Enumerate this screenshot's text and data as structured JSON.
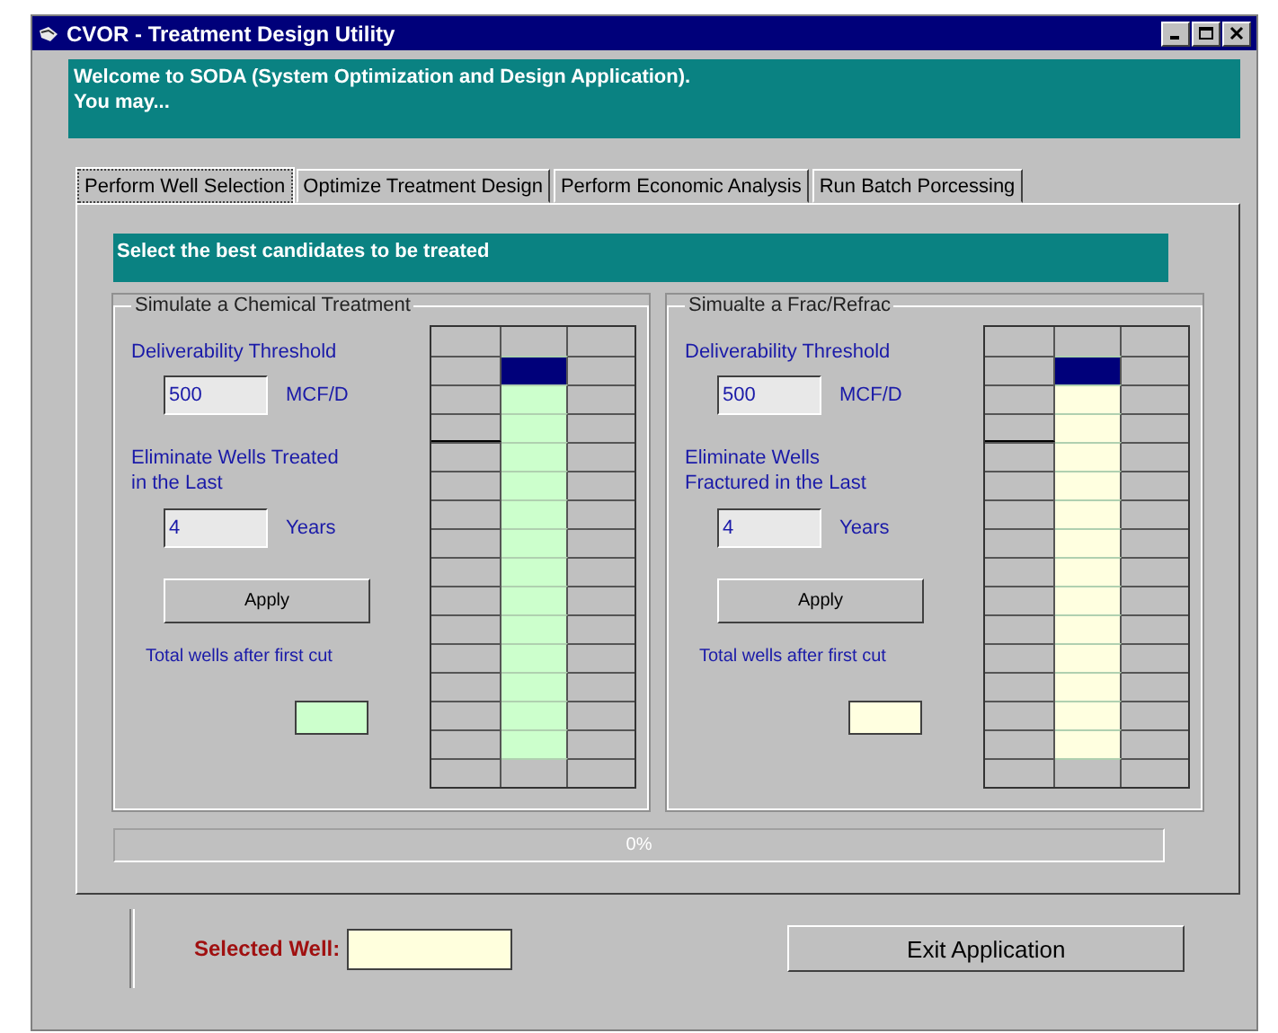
{
  "window": {
    "title": "CVOR - Treatment Design Utility"
  },
  "banner": {
    "lines": [
      "Welcome to SODA (System Optimization and Design Application).",
      "You may..."
    ]
  },
  "tabs": [
    {
      "label": "Perform Well Selection",
      "selected": true
    },
    {
      "label": "Optimize Treatment Design",
      "selected": false
    },
    {
      "label": "Perform Economic Analysis",
      "selected": false
    },
    {
      "label": "Run Batch Porcessing",
      "selected": false
    }
  ],
  "panel": {
    "heading": "Select the best candidates to be treated",
    "groups": [
      {
        "legend": "Simulate a Chemical Treatment",
        "color": "#ccffcc",
        "threshold_label": "Deliverability Threshold",
        "threshold_value": "500",
        "threshold_unit": "MCF/D",
        "eliminate_lines": [
          "Eliminate Wells Treated",
          "in the Last"
        ],
        "years_value": "4",
        "years_unit": "Years",
        "apply_button": "Apply",
        "total_label": "Total wells after first cut"
      },
      {
        "legend": "Simualte a Frac/Refrac",
        "color": "#ffffe0",
        "threshold_label": "Deliverability Threshold",
        "threshold_value": "500",
        "threshold_unit": "MCF/D",
        "eliminate_lines": [
          "Eliminate Wells",
          "Fractured in the Last"
        ],
        "years_value": "4",
        "years_unit": "Years",
        "apply_button": "Apply",
        "total_label": "Total wells after first cut"
      }
    ],
    "progress": {
      "level": 0,
      "reading": "0%"
    }
  },
  "footer": {
    "selected_well_label": "Selected Well:",
    "exit_button": "Exit Application"
  }
}
